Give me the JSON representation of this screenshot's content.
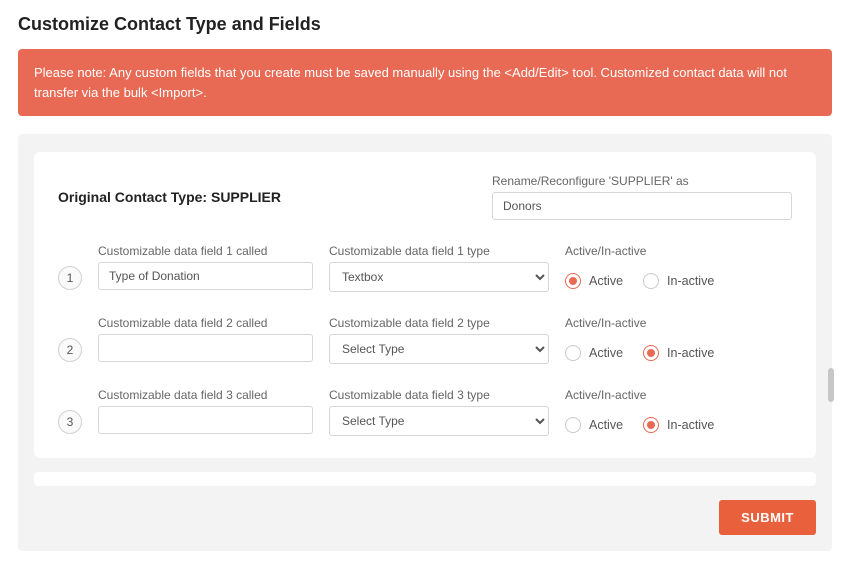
{
  "page_title": "Customize Contact Type and Fields",
  "alert_text": "Please note: Any custom fields that you create must be saved manually using the <Add/Edit> tool. Customized contact data will not transfer via the bulk <Import>.",
  "original_label_prefix": "Original Contact Type: ",
  "original_label_value": "SUPPLIER",
  "rename_label": "Rename/Reconfigure 'SUPPLIER' as",
  "rename_value": "Donors",
  "type_options": {
    "placeholder": "Select Type",
    "textbox": "Textbox"
  },
  "status_header": "Active/In-active",
  "status_active": "Active",
  "status_inactive": "In-active",
  "rows": [
    {
      "step": "1",
      "name_label": "Customizable data field 1 called",
      "name_value": "Type of Donation",
      "type_label": "Customizable data field 1 type",
      "type_value": "Textbox",
      "active": true
    },
    {
      "step": "2",
      "name_label": "Customizable data field 2 called",
      "name_value": "",
      "type_label": "Customizable data field 2 type",
      "type_value": "Select Type",
      "active": false
    },
    {
      "step": "3",
      "name_label": "Customizable data field 3 called",
      "name_value": "",
      "type_label": "Customizable data field 3 type",
      "type_value": "Select Type",
      "active": false
    }
  ],
  "submit_label": "SUBMIT"
}
